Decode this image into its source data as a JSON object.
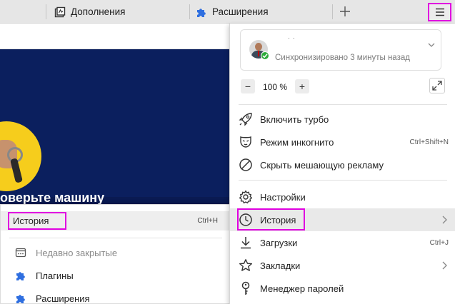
{
  "tabs": [
    {
      "label": "Дополнения",
      "icon": "addons-icon"
    },
    {
      "label": "Расширения",
      "icon": "puzzle-icon"
    }
  ],
  "page": {
    "title": "оверьте машину"
  },
  "submenu": {
    "history_label": "История",
    "history_shortcut": "Ctrl+H",
    "items": [
      {
        "label": "Недавно закрытые",
        "icon": "recent-tabs-icon",
        "disabled": true
      },
      {
        "label": "Плагины",
        "icon": "puzzle-icon",
        "disabled": false
      },
      {
        "label": "Расширения",
        "icon": "puzzle-icon",
        "disabled": false
      }
    ]
  },
  "menu": {
    "account": {
      "name": "· ·",
      "status": "Синхронизировано 3 минуты назад"
    },
    "zoom": {
      "minus": "−",
      "value": "100 %",
      "plus": "+"
    },
    "group1": [
      {
        "label": "Включить турбо",
        "icon": "rocket-icon",
        "shortcut": ""
      },
      {
        "label": "Режим инкогнито",
        "icon": "incognito-mask-icon",
        "shortcut": "Ctrl+Shift+N"
      },
      {
        "label": "Скрыть мешающую рекламу",
        "icon": "block-ads-icon",
        "shortcut": ""
      }
    ],
    "group2": [
      {
        "label": "Настройки",
        "icon": "gear-icon",
        "shortcut": ""
      },
      {
        "label": "История",
        "icon": "clock-icon",
        "shortcut": ""
      },
      {
        "label": "Загрузки",
        "icon": "download-icon",
        "shortcut": "Ctrl+J"
      },
      {
        "label": "Закладки",
        "icon": "star-icon",
        "shortcut": ""
      },
      {
        "label": "Менеджер паролей",
        "icon": "key-icon",
        "shortcut": ""
      }
    ]
  },
  "colors": {
    "highlight": "#e000e0",
    "page_bg": "#0b1f5e",
    "accent_yellow": "#f6cd1c",
    "puzzle_blue": "#2f6fe0",
    "sync_green": "#2dab3b"
  }
}
